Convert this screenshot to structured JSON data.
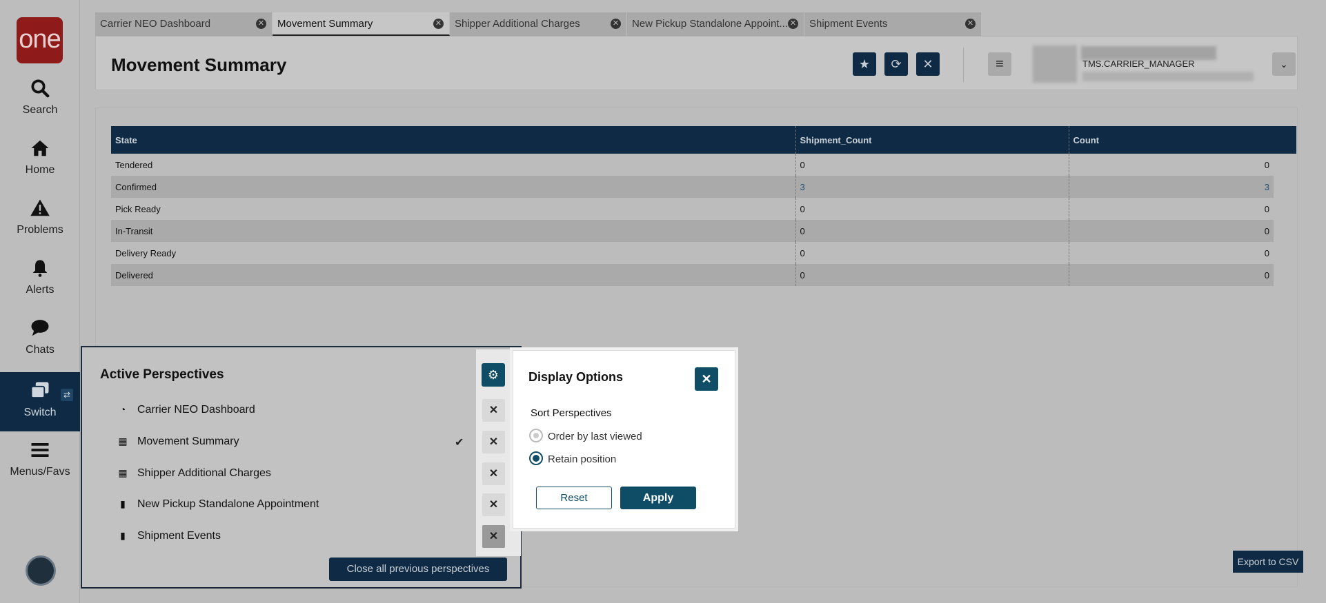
{
  "app": {
    "logo_text": "one"
  },
  "nav": [
    {
      "label": "Search",
      "icon": "search-icon"
    },
    {
      "label": "Home",
      "icon": "home-icon"
    },
    {
      "label": "Problems",
      "icon": "warning-icon"
    },
    {
      "label": "Alerts",
      "icon": "bell-icon"
    },
    {
      "label": "Chats",
      "icon": "chat-icon"
    },
    {
      "label": "Switch",
      "icon": "switch-icon",
      "badge": "⇄"
    },
    {
      "label": "Menus/Favs",
      "icon": "menu-icon"
    }
  ],
  "tabs": [
    {
      "label": "Carrier NEO Dashboard"
    },
    {
      "label": "Movement Summary"
    },
    {
      "label": "Shipper Additional Charges"
    },
    {
      "label": "New Pickup Standalone Appoint..."
    },
    {
      "label": "Shipment Events"
    }
  ],
  "header": {
    "title": "Movement Summary",
    "user_role": "TMS.CARRIER_MANAGER"
  },
  "table": {
    "columns": [
      "State",
      "Shipment_Count",
      "Count"
    ],
    "rows": [
      [
        "Tendered",
        "0",
        "0"
      ],
      [
        "Confirmed",
        "3",
        "3"
      ],
      [
        "Pick Ready",
        "0",
        "0"
      ],
      [
        "In-Transit",
        "0",
        "0"
      ],
      [
        "Delivery Ready",
        "0",
        "0"
      ],
      [
        "Delivered",
        "0",
        "0"
      ]
    ]
  },
  "export_label": "Export to CSV",
  "perspectives": {
    "title": "Active Perspectives",
    "items": [
      {
        "label": "Carrier NEO Dashboard",
        "icon": "pie-chart-icon"
      },
      {
        "label": "Movement Summary",
        "icon": "table-icon",
        "current": true
      },
      {
        "label": "Shipper Additional Charges",
        "icon": "table-icon"
      },
      {
        "label": "New Pickup Standalone Appointment",
        "icon": "document-icon"
      },
      {
        "label": "Shipment Events",
        "icon": "document-icon"
      }
    ],
    "close_all_label": "Close all previous perspectives"
  },
  "display_options": {
    "title": "Display Options",
    "sort_label": "Sort Perspectives",
    "options": [
      {
        "label": "Order by last viewed",
        "selected": false
      },
      {
        "label": "Retain position",
        "selected": true
      }
    ],
    "reset_label": "Reset",
    "apply_label": "Apply"
  }
}
